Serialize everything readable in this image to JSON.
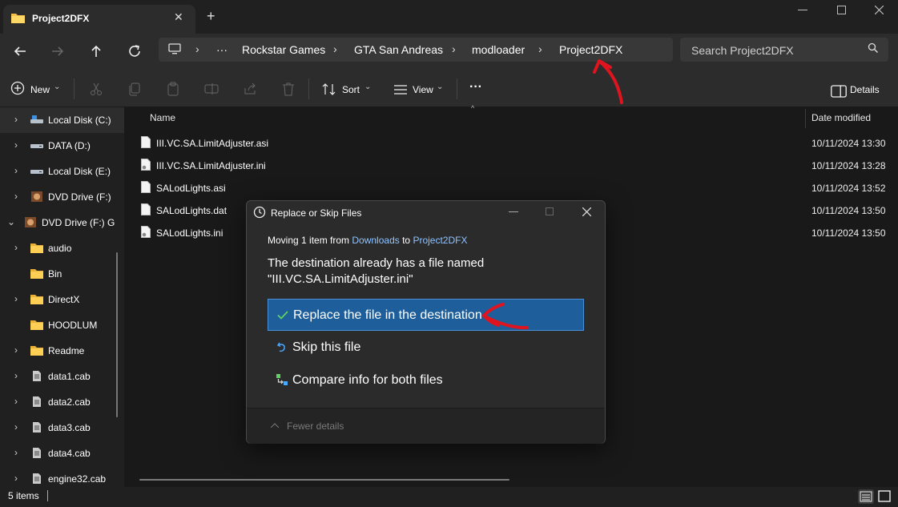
{
  "window": {
    "tab_title": "Project2DFX",
    "tab_close": "✕",
    "new_tab": "+"
  },
  "nav": {
    "breadcrumb": [
      "Rockstar Games",
      "GTA San Andreas",
      "modloader",
      "Project2DFX"
    ],
    "overflow": "···",
    "search_placeholder": "Search Project2DFX"
  },
  "toolbar": {
    "new_label": "New",
    "sort_label": "Sort",
    "view_label": "View",
    "more_label": "···",
    "details_label": "Details"
  },
  "sidebar": {
    "items": [
      {
        "label": "Local Disk (C:)",
        "icon": "drive-c-icon"
      },
      {
        "label": "DATA (D:)",
        "icon": "drive-icon"
      },
      {
        "label": "Local Disk (E:)",
        "icon": "drive-icon"
      },
      {
        "label": "DVD Drive (F:)",
        "icon": "dvd-icon"
      },
      {
        "label": "DVD Drive (F:) G",
        "icon": "dvd-icon"
      },
      {
        "label": "audio",
        "icon": "folder-icon"
      },
      {
        "label": "Bin",
        "icon": "folder-icon"
      },
      {
        "label": "DirectX",
        "icon": "folder-icon"
      },
      {
        "label": "HOODLUM",
        "icon": "folder-icon"
      },
      {
        "label": "Readme",
        "icon": "folder-icon"
      },
      {
        "label": "data1.cab",
        "icon": "cab-file-icon"
      },
      {
        "label": "data2.cab",
        "icon": "cab-file-icon"
      },
      {
        "label": "data3.cab",
        "icon": "cab-file-icon"
      },
      {
        "label": "data4.cab",
        "icon": "cab-file-icon"
      },
      {
        "label": "engine32.cab",
        "icon": "cab-file-icon"
      }
    ]
  },
  "files": {
    "col_name": "Name",
    "col_date": "Date modified",
    "rows": [
      {
        "name": "III.VC.SA.LimitAdjuster.asi",
        "date": "10/11/2024 13:30"
      },
      {
        "name": "III.VC.SA.LimitAdjuster.ini",
        "date": "10/11/2024 13:28"
      },
      {
        "name": "SALodLights.asi",
        "date": "10/11/2024 13:52"
      },
      {
        "name": "SALodLights.dat",
        "date": "10/11/2024 13:50"
      },
      {
        "name": "SALodLights.ini",
        "date": "10/11/2024 13:50"
      }
    ]
  },
  "status": {
    "items_count": "5 items"
  },
  "dialog": {
    "title": "Replace or Skip Files",
    "moving_prefix": "Moving 1 item from ",
    "source": "Downloads",
    "moving_to": " to ",
    "destination": "Project2DFX",
    "message_line1": "The destination already has a file named",
    "message_line2": "\"III.VC.SA.LimitAdjuster.ini\"",
    "option_replace": "Replace the file in the destination",
    "option_skip": "Skip this file",
    "option_compare": "Compare info for both files",
    "fewer_details": "Fewer details"
  },
  "colors": {
    "accent": "#1e5e9a",
    "link": "#8fc3ff",
    "annotation": "#e0141e"
  }
}
